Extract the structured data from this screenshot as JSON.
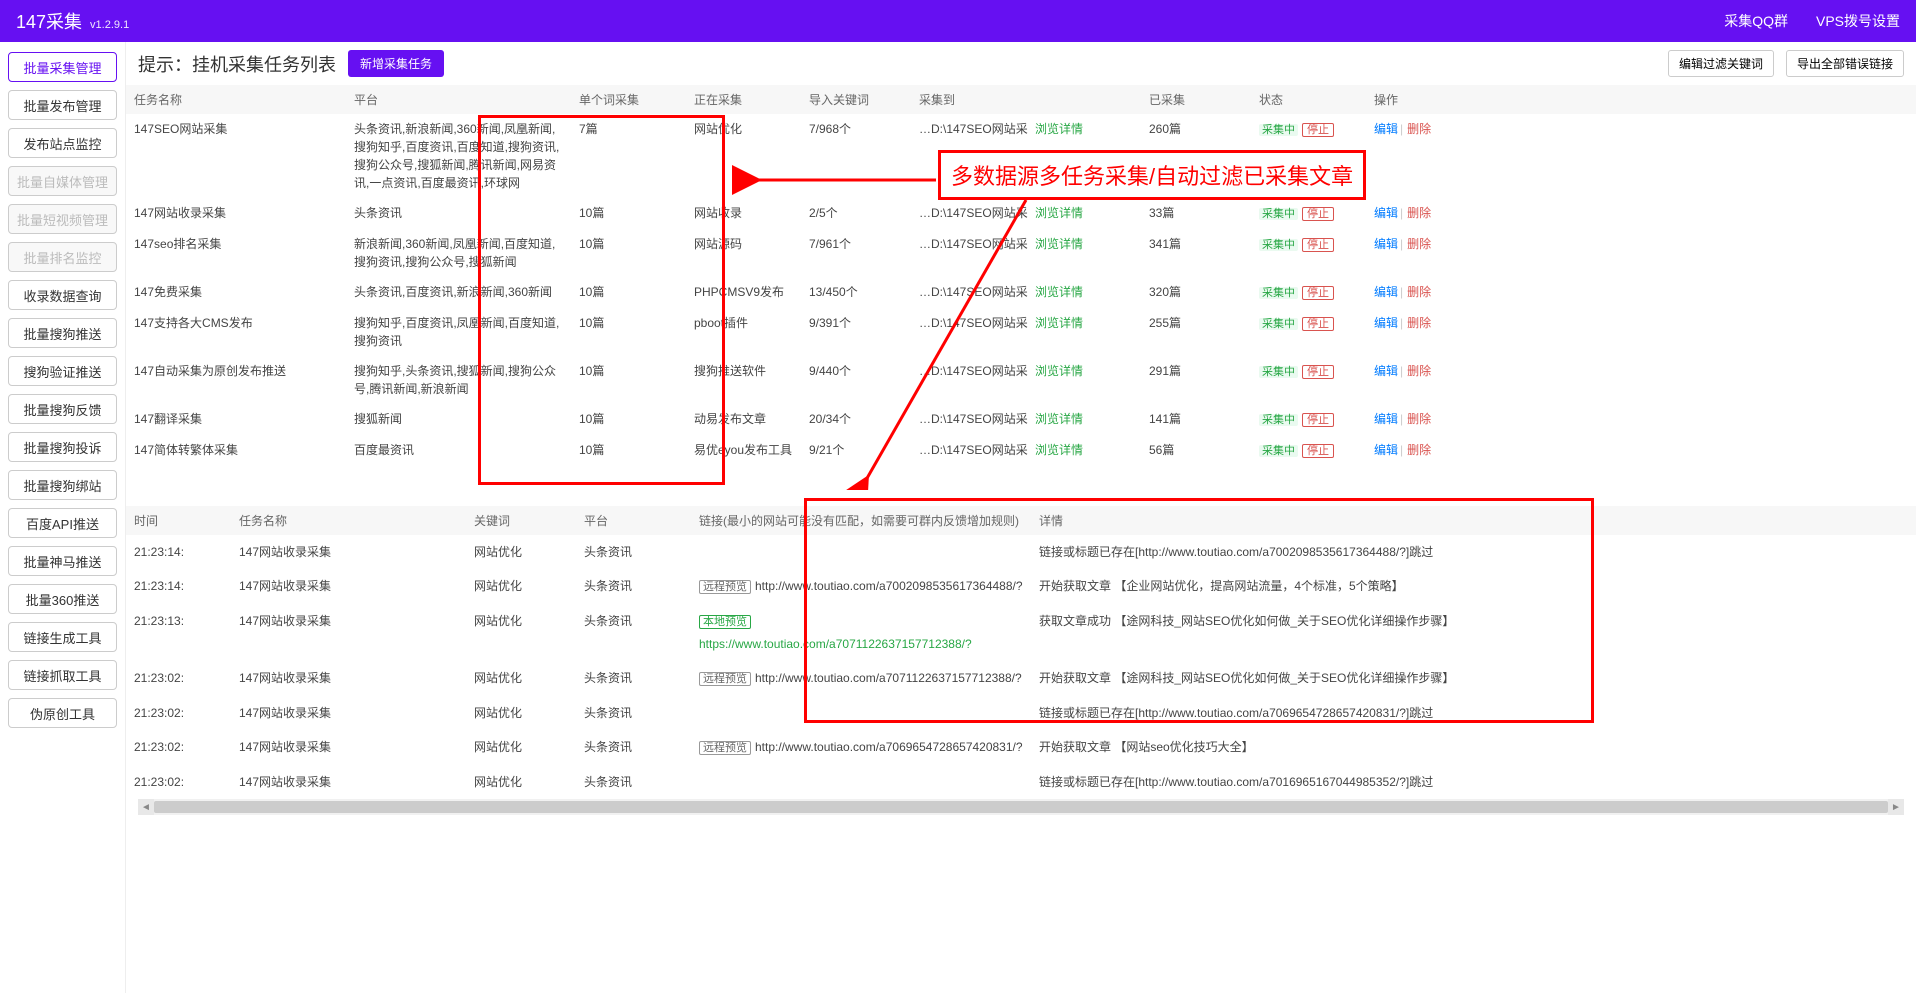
{
  "header": {
    "title": "147采集",
    "version": "v1.2.9.1",
    "links": {
      "qq": "采集QQ群",
      "vps": "VPS拨号设置"
    }
  },
  "sidebar": {
    "items": [
      {
        "label": "批量采集管理",
        "state": "active"
      },
      {
        "label": "批量发布管理",
        "state": ""
      },
      {
        "label": "发布站点监控",
        "state": ""
      },
      {
        "label": "批量自媒体管理",
        "state": "disabled"
      },
      {
        "label": "批量短视频管理",
        "state": "disabled"
      },
      {
        "label": "批量排名监控",
        "state": "disabled"
      },
      {
        "label": "收录数据查询",
        "state": ""
      },
      {
        "label": "批量搜狗推送",
        "state": ""
      },
      {
        "label": "搜狗验证推送",
        "state": ""
      },
      {
        "label": "批量搜狗反馈",
        "state": ""
      },
      {
        "label": "批量搜狗投诉",
        "state": ""
      },
      {
        "label": "批量搜狗绑站",
        "state": ""
      },
      {
        "label": "百度API推送",
        "state": ""
      },
      {
        "label": "批量神马推送",
        "state": ""
      },
      {
        "label": "批量360推送",
        "state": ""
      },
      {
        "label": "链接生成工具",
        "state": ""
      },
      {
        "label": "链接抓取工具",
        "state": ""
      },
      {
        "label": "伪原创工具",
        "state": ""
      }
    ]
  },
  "toolbar": {
    "hint_prefix": "提示：",
    "hint": "挂机采集任务列表",
    "add_btn": "新增采集任务",
    "filter_btn": "编辑过滤关键词",
    "export_btn": "导出全部错误链接"
  },
  "callout": "多数据源多任务采集/自动过滤已采集文章",
  "tasks": {
    "cols": {
      "name": "任务名称",
      "platform": "平台",
      "single": "单个词采集",
      "current": "正在采集",
      "imp": "导入关键词",
      "dest": "采集到",
      "count": "已采集",
      "status": "状态",
      "ops": "操作"
    },
    "detail_link": "浏览详情",
    "status_label": "采集中",
    "stop_label": "停止",
    "edit_label": "编辑",
    "del_label": "删除",
    "dest_prefix": "…D:\\147SEO网站采",
    "rows": [
      {
        "name": "147SEO网站采集",
        "platform": "头条资讯,新浪新闻,360新闻,凤凰新闻,搜狗知乎,百度资讯,百度知道,搜狗资讯,搜狗公众号,搜狐新闻,腾讯新闻,网易资讯,一点资讯,百度最资讯,环球网",
        "single": "7篇",
        "current": "网站优化",
        "imp": "7/968个",
        "count": "260篇"
      },
      {
        "name": "147网站收录采集",
        "platform": "头条资讯",
        "single": "10篇",
        "current": "网站收录",
        "imp": "2/5个",
        "count": "33篇"
      },
      {
        "name": "147seo排名采集",
        "platform": "新浪新闻,360新闻,凤凰新闻,百度知道,搜狗资讯,搜狗公众号,搜狐新闻",
        "single": "10篇",
        "current": "网站源码",
        "imp": "7/961个",
        "count": "341篇"
      },
      {
        "name": "147免费采集",
        "platform": "头条资讯,百度资讯,新浪新闻,360新闻",
        "single": "10篇",
        "current": "PHPCMSV9发布",
        "imp": "13/450个",
        "count": "320篇"
      },
      {
        "name": "147支持各大CMS发布",
        "platform": "搜狗知乎,百度资讯,凤凰新闻,百度知道,搜狗资讯",
        "single": "10篇",
        "current": "pboot插件",
        "imp": "9/391个",
        "count": "255篇"
      },
      {
        "name": "147自动采集为原创发布推送",
        "platform": "搜狗知乎,头条资讯,搜狐新闻,搜狗公众号,腾讯新闻,新浪新闻",
        "single": "10篇",
        "current": "搜狗推送软件",
        "imp": "9/440个",
        "count": "291篇"
      },
      {
        "name": "147翻译采集",
        "platform": "搜狐新闻",
        "single": "10篇",
        "current": "动易发布文章",
        "imp": "20/34个",
        "count": "141篇"
      },
      {
        "name": "147简体转繁体采集",
        "platform": "百度最资讯",
        "single": "10篇",
        "current": "易优eyou发布工具",
        "imp": "9/21个",
        "count": "56篇"
      }
    ]
  },
  "logs": {
    "cols": {
      "time": "时间",
      "name": "任务名称",
      "kw": "关键词",
      "platform": "平台",
      "link": "链接(最小的网站可能没有匹配，如需要可群内反馈增加规则)",
      "detail": "详情"
    },
    "remote_badge": "远程预览",
    "local_badge": "本地预览",
    "rows": [
      {
        "time": "21:23:14:",
        "name": "147网站收录采集",
        "kw": "网站优化",
        "platform": "头条资讯",
        "badge": "",
        "url": "",
        "detail": "链接或标题已存在[http://www.toutiao.com/a7002098535617364488/?]跳过"
      },
      {
        "time": "21:23:14:",
        "name": "147网站收录采集",
        "kw": "网站优化",
        "platform": "头条资讯",
        "badge": "remote",
        "url": "http://www.toutiao.com/a7002098535617364488/?",
        "detail": "开始获取文章 【企业网站优化，提高网站流量，4个标准，5个策略】"
      },
      {
        "time": "21:23:13:",
        "name": "147网站收录采集",
        "kw": "网站优化",
        "platform": "头条资讯",
        "badge": "local",
        "url": "https://www.toutiao.com/a7071122637157712388/?",
        "detail": "获取文章成功 【途网科技_网站SEO优化如何做_关于SEO优化详细操作步骤】"
      },
      {
        "time": "21:23:02:",
        "name": "147网站收录采集",
        "kw": "网站优化",
        "platform": "头条资讯",
        "badge": "remote",
        "url": "http://www.toutiao.com/a7071122637157712388/?",
        "detail": "开始获取文章 【途网科技_网站SEO优化如何做_关于SEO优化详细操作步骤】"
      },
      {
        "time": "21:23:02:",
        "name": "147网站收录采集",
        "kw": "网站优化",
        "platform": "头条资讯",
        "badge": "",
        "url": "",
        "detail": "链接或标题已存在[http://www.toutiao.com/a7069654728657420831/?]跳过"
      },
      {
        "time": "21:23:02:",
        "name": "147网站收录采集",
        "kw": "网站优化",
        "platform": "头条资讯",
        "badge": "remote",
        "url": "http://www.toutiao.com/a7069654728657420831/?",
        "detail": "开始获取文章 【网站seo优化技巧大全】"
      },
      {
        "time": "21:23:02:",
        "name": "147网站收录采集",
        "kw": "网站优化",
        "platform": "头条资讯",
        "badge": "",
        "url": "",
        "detail": "链接或标题已存在[http://www.toutiao.com/a7016965167044985352/?]跳过"
      }
    ]
  }
}
